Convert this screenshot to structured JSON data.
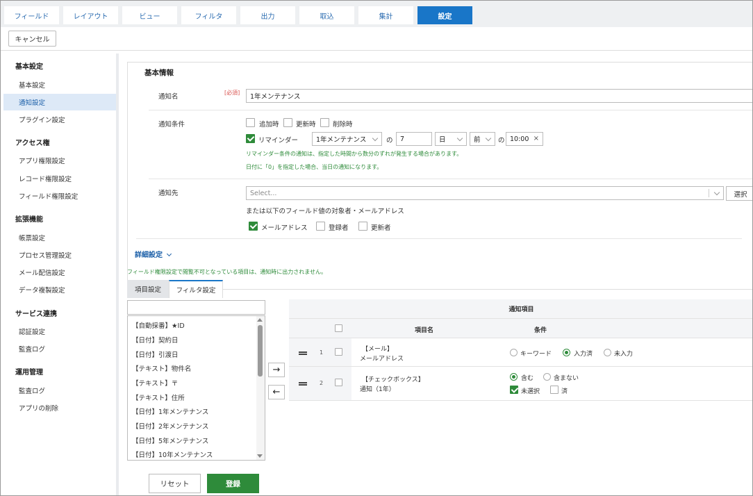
{
  "top_tabs": [
    {
      "label": "フィールド"
    },
    {
      "label": "レイアウト"
    },
    {
      "label": "ビュー"
    },
    {
      "label": "フィルタ"
    },
    {
      "label": "出力"
    },
    {
      "label": "取込"
    },
    {
      "label": "集計"
    },
    {
      "label": "設定",
      "active": true
    }
  ],
  "toolbar": {
    "cancel_label": "キャンセル"
  },
  "sidebar": {
    "groups": [
      {
        "heading": "基本設定",
        "items": [
          "基本設定",
          "通知設定",
          "プラグイン設定"
        ]
      },
      {
        "heading": "アクセス権",
        "items": [
          "アプリ権限設定",
          "レコード権限設定",
          "フィールド権限設定"
        ]
      },
      {
        "heading": "拡張機能",
        "items": [
          "帳票設定",
          "プロセス管理設定",
          "メール配信設定",
          "データ複製設定"
        ]
      },
      {
        "heading": "サービス連携",
        "items": [
          "認証設定",
          "監査ログ"
        ]
      },
      {
        "heading": "運用管理",
        "items": [
          "監査ログ",
          "アプリの削除"
        ]
      }
    ],
    "active_item": "通知設定"
  },
  "basic_info": {
    "title": "基本情報",
    "name_label": "通知名",
    "required": "[必須]",
    "name_value": "1年メンテナンス",
    "condition_label": "通知条件",
    "conditions": {
      "on_add": "追加時",
      "on_update": "更新時",
      "on_delete": "削除時",
      "reminder": "リマインダー",
      "reminder_field": "1年メンテナンス",
      "no1": "の",
      "offset": "7",
      "unit": "日",
      "direction": "前",
      "no2": "の",
      "time": "10:00",
      "clear": "×",
      "note1": "リマインダー条件の通知は、指定した時間から数分のずれが発生する場合があります。",
      "note2": "日付に「0」を指定した場合、当日の通知になります。"
    },
    "recipient_label": "通知先",
    "recipient_placeholder": "Select...",
    "select_button": "選択",
    "recipient_note": "または以下のフィールド値の対象者・メールアドレス",
    "recipients": {
      "email": "メールアドレス",
      "creator": "登録者",
      "updater": "更新者"
    }
  },
  "advanced": {
    "label": "詳細設定"
  },
  "fields_note": "フィールド権限設定で閲覧不可となっている項目は、通知時に出力されません。",
  "subtabs": {
    "items": "項目設定",
    "filter": "フィルタ設定"
  },
  "picker": {
    "items": [
      "【自動採番】★ID",
      "【日付】契約日",
      "【日付】引渡日",
      "【テキスト】物件名",
      "【テキスト】〒",
      "【テキスト】住所",
      "【日付】1年メンテナンス",
      "【日付】2年メンテナンス",
      "【日付】5年メンテナンス",
      "【日付】10年メンテナンス"
    ]
  },
  "move": {
    "right": "→",
    "left": "←"
  },
  "table": {
    "title": "通知項目",
    "col_name": "項目名",
    "col_condition": "条件",
    "rows": [
      {
        "num": "1",
        "type": "【メール】",
        "name": "メールアドレス",
        "options": {
          "keyword": "キーワード",
          "filled": "入力済",
          "empty": "未入力"
        }
      },
      {
        "num": "2",
        "type": "【チェックボックス】",
        "name": "通知（1年）",
        "options": {
          "include": "含む",
          "exclude": "含まない",
          "unselected": "未選択",
          "done": "済"
        }
      }
    ]
  },
  "footer": {
    "reset": "リセット",
    "save": "登録"
  },
  "colors": {
    "accent": "#1976c8",
    "primary": "#2e8b3a",
    "active_nav_bg": "#dde9f7"
  }
}
